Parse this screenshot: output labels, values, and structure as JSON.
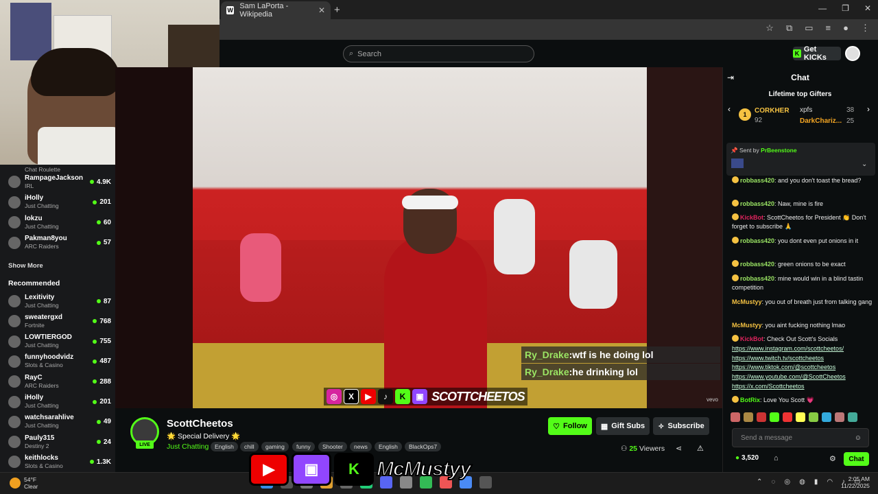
{
  "browser": {
    "tab_title": "Sam LaPorta - Wikipedia",
    "tab_favicon": "W",
    "new_tab": "+",
    "close_tab": "✕",
    "window_controls": [
      "—",
      "❐",
      "✕"
    ]
  },
  "kick_header": {
    "search_placeholder": "Search",
    "get_kicks": "Get KICKs"
  },
  "sidebar": {
    "top_partial_category": "Chat Roulette",
    "following": [
      {
        "name": "RampageJackson",
        "category": "IRL",
        "viewers": "4.9K"
      },
      {
        "name": "iHolly",
        "category": "Just Chatting",
        "viewers": "201"
      },
      {
        "name": "lokzu",
        "category": "Just Chatting",
        "viewers": "60"
      },
      {
        "name": "Pakman8you",
        "category": "ARC Raiders",
        "viewers": "57"
      }
    ],
    "show_more": "Show More",
    "recommended_heading": "Recommended",
    "recommended": [
      {
        "name": "Lexitivity",
        "category": "Just Chatting",
        "viewers": "87"
      },
      {
        "name": "sweatergxd",
        "category": "Fortnite",
        "viewers": "768"
      },
      {
        "name": "LOWTIERGOD",
        "category": "Just Chatting",
        "viewers": "755"
      },
      {
        "name": "funnyhoodvidz",
        "category": "Slots & Casino",
        "viewers": "487"
      },
      {
        "name": "RayC",
        "category": "ARC Raiders",
        "viewers": "288"
      },
      {
        "name": "iHolly",
        "category": "Just Chatting",
        "viewers": "201"
      },
      {
        "name": "watchsarahlive",
        "category": "Just Chatting",
        "viewers": "49"
      },
      {
        "name": "Pauly315",
        "category": "Destiny 2",
        "viewers": "24"
      },
      {
        "name": "keithlocks",
        "category": "Slots & Casino",
        "viewers": "1.3K"
      }
    ]
  },
  "video": {
    "overlay_messages": [
      {
        "user": "Ry_Drake",
        "sep": " : ",
        "text": "wtf is he doing lol"
      },
      {
        "user": "Ry_Drake",
        "sep": " : ",
        "text": "he drinking lol"
      }
    ],
    "social_name": "SCOTTCHEETOS",
    "watermark": "vevo"
  },
  "channel": {
    "name": "ScottCheetos",
    "title": "🌟 Special Delivery 🌟",
    "category": "Just Chatting",
    "live": "LIVE",
    "tags": [
      "English",
      "chill",
      "gaming",
      "funny",
      "Shooter",
      "news",
      "English",
      "BlackOps7"
    ],
    "follow": "Follow",
    "gift_subs": "Gift Subs",
    "subscribe": "Subscribe",
    "viewers": "25",
    "viewers_label": "Viewers"
  },
  "chat": {
    "title": "Chat",
    "gifters_title": "Lifetime top Gifters",
    "gifters": [
      {
        "name": "CORKHER",
        "count": "92",
        "rank": "1"
      },
      {
        "name": "xpfs",
        "count": "38"
      },
      {
        "name": "DarkChariz...",
        "count": "25"
      }
    ],
    "pinned_label": "Sent by",
    "pinned_user": "PrBeenstone",
    "messages": [
      {
        "user": "robbass420",
        "text": "and you don't toast the bread?",
        "color": "#9be564"
      },
      {
        "user": "robbass420",
        "text": "Naw, mine is fire",
        "color": "#9be564"
      },
      {
        "user": "KickBot",
        "text": "ScottCheetos for President 👏 Don't forget to subscribe 🙏",
        "color": "#e0245e"
      },
      {
        "user": "robbass420",
        "text": "you dont even put onions in it",
        "color": "#9be564"
      },
      {
        "user": "robbass420",
        "text": "green onions to be exact",
        "color": "#9be564"
      },
      {
        "user": "robbass420",
        "text": "mine would win in a blind tastin competition",
        "color": "#9be564"
      },
      {
        "user": "McMustyy",
        "text": "you out of breath just from talking gang",
        "color": "#f5c242"
      },
      {
        "user": "McMustyy",
        "text": "you aint fucking nothing lmao",
        "color": "#f5c242"
      },
      {
        "user": "KickBot",
        "text": "Check Out Scott's Socials",
        "color": "#e0245e"
      },
      {
        "user": "BotRix",
        "text": "Love You Scott 💗",
        "color": "#53fc18"
      }
    ],
    "links": [
      "https://www.instagram.com/scottcheetos/",
      "https://www.twitch.tv/scottcheetos",
      "https://www.tiktok.com/@scottcheetos",
      "https://www.youtube.com/@ScottCheetos",
      "https://x.com/Scottcheetos"
    ],
    "send_placeholder": "Send a message",
    "points": "3,520",
    "chat_button": "Chat"
  },
  "stream_overlay": {
    "banner_name": "McMustyy"
  },
  "taskbar": {
    "temp": "54°F",
    "weather": "Clear",
    "time": "2:05 AM",
    "date": "11/22/2025"
  },
  "colors": {
    "kick_green": "#53fc18",
    "bg": "#0b0e0f"
  }
}
